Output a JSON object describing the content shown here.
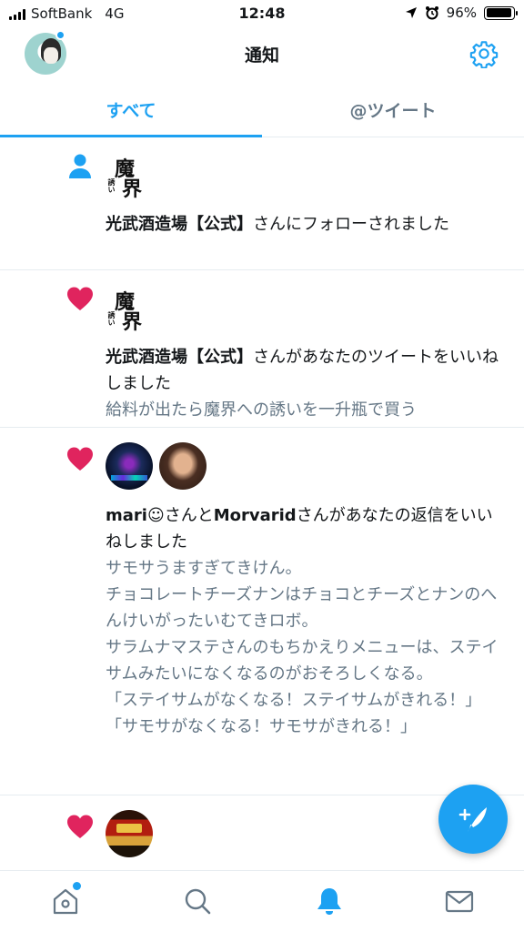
{
  "status_bar": {
    "carrier": "SoftBank",
    "network": "4G",
    "time": "12:48",
    "battery": "96%",
    "battery_level": 0.96
  },
  "header": {
    "title": "通知"
  },
  "tabs": [
    {
      "label": "すべて",
      "active": true
    },
    {
      "label": "@ツイート",
      "active": false
    }
  ],
  "notifications": [
    {
      "type": "follow",
      "icon": "person-icon",
      "actor": "光武酒造場【公式】",
      "action": "さんにフォローされました",
      "tweet_lines": []
    },
    {
      "type": "like",
      "icon": "heart-icon",
      "actor": "光武酒造場【公式】",
      "action": "さんがあなたのツイートをいいねしました",
      "tweet_lines": [
        "給料が出たら魔界への誘いを一升瓶で買う"
      ]
    },
    {
      "type": "like",
      "icon": "heart-icon",
      "actor1": "mari☺",
      "mid": "さんと",
      "actor2": "Morvarid",
      "action": "さんがあなたの返信をいいねしました",
      "tweet_lines": [
        "サモサうますぎてきけん。",
        "チョコレートチーズナンはチョコとチーズとナンのへんけいがったいむてきロボ。",
        "サラムナマステさんのもちかえりメニューは、ステイサムみたいになくなるのがおそろしくなる。",
        "「ステイサムがなくなる！ステイサムがきれる！」",
        "「サモサがなくなる！サモサがきれる！」"
      ]
    },
    {
      "type": "like",
      "icon": "heart-icon",
      "tweet_lines": []
    }
  ],
  "logo_text": {
    "big1": "魔",
    "big2": "界",
    "small": "誘い"
  },
  "colors": {
    "accent": "#1da1f2",
    "like": "#e0245e",
    "secondary_text": "#657786",
    "divider": "#e6ecf0"
  },
  "bottom_nav": [
    {
      "name": "home-icon",
      "active": false,
      "badge": true
    },
    {
      "name": "search-icon",
      "active": false,
      "badge": false
    },
    {
      "name": "bell-icon",
      "active": true,
      "badge": false
    },
    {
      "name": "mail-icon",
      "active": false,
      "badge": false
    }
  ]
}
